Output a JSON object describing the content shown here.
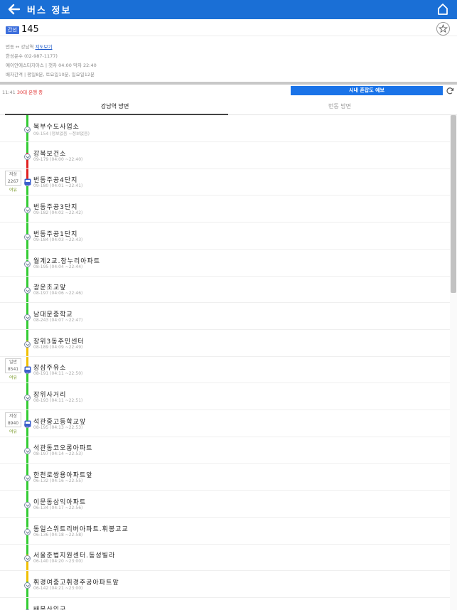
{
  "header": {
    "title": "버스 정보"
  },
  "route": {
    "badge": "간선",
    "number": "145",
    "direction": "번동 ↔ 강남역",
    "map_link": "지도보기",
    "company": "한성운수 (02-987-1177)",
    "hours": "예이안에스타지아스 |  첫차 04:00  막차 22:40",
    "interval": "배차간격  |  평일8분, 토요일10분, 일요일12분"
  },
  "status": {
    "time": "11:41",
    "running": "30대 운행 중"
  },
  "forecast_button": "시내 혼잡도 예보",
  "tabs": {
    "active": "강남역 방면",
    "inactive": "번동 방면"
  },
  "stops": [
    {
      "name": "북부수도사업소",
      "sub": "09-154 (정보없음 ~정보없음)"
    },
    {
      "name": "강북보건소",
      "sub": "09-179 (04:00 ~22:40)"
    },
    {
      "name": "번동주공4단지",
      "sub": "09-180 (04:01 ~22:41)"
    },
    {
      "name": "번동주공3단지",
      "sub": "09-182 (04:02 ~22:42)"
    },
    {
      "name": "번동주공1단지",
      "sub": "09-184 (04:03 ~22:43)"
    },
    {
      "name": "월계2교.참누리아파트",
      "sub": "08-195 (04:04 ~22:44)"
    },
    {
      "name": "광운초교앞",
      "sub": "08-197 (04:06 ~22:46)"
    },
    {
      "name": "남대문중학교",
      "sub": "08-243 (04:07 ~22:47)"
    },
    {
      "name": "장위3동주민센터",
      "sub": "08-189 (04:09 ~22:49)"
    },
    {
      "name": "장삼주유소",
      "sub": "08-191 (04:11 ~22:50)"
    },
    {
      "name": "장위사거리",
      "sub": "08-193 (04:11 ~22:51)"
    },
    {
      "name": "석관중고등학교앞",
      "sub": "08-195 (04:13 ~22:53)"
    },
    {
      "name": "석관동코오롱아파트",
      "sub": "08-197 (04:14 ~22:53)"
    },
    {
      "name": "한천로쌍용아파트앞",
      "sub": "06-132 (04:16 ~22:55)"
    },
    {
      "name": "이문동삼익아파트",
      "sub": "06-134 (04:17 ~22:56)"
    },
    {
      "name": "동일스위트리버아파트.휘봉고교",
      "sub": "06-136 (04:18 ~22:58)"
    },
    {
      "name": "서울준법지원센터.동성빌라",
      "sub": "06-140 (04:20 ~23:00)"
    },
    {
      "name": "휘경여중고휘경주공아파트앞",
      "sub": "06-142 (04:21 ~23:00)"
    },
    {
      "name": "배봉산입구",
      "sub": ""
    }
  ],
  "buses": [
    {
      "type": "저상",
      "number": "2267",
      "state": "여유"
    },
    {
      "type": "일반",
      "number": "8541",
      "state": "여유"
    },
    {
      "type": "저상",
      "number": "8940",
      "state": "여유"
    }
  ],
  "colors": {
    "topbar": "#1a6fd6",
    "line_green": "#33cc33",
    "line_red": "#e02020",
    "line_yellow": "#f0c000",
    "bus": "#3a5fcd",
    "running": "#e03030",
    "state": "#7a9a2a"
  },
  "icons": [
    "back-arrow-icon",
    "home-icon",
    "star-icon",
    "refresh-icon",
    "bus-icon",
    "stop-chevron-icon"
  ]
}
